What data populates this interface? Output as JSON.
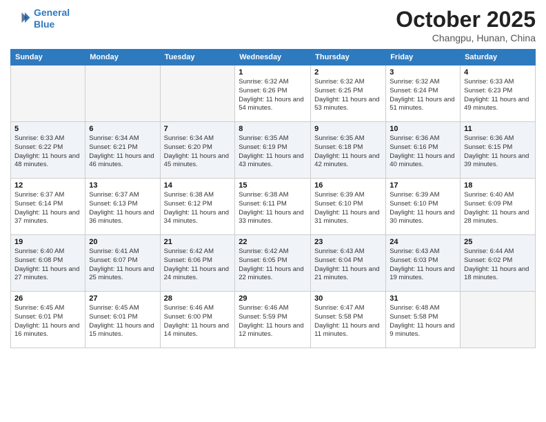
{
  "header": {
    "logo_line1": "General",
    "logo_line2": "Blue",
    "month": "October 2025",
    "location": "Changpu, Hunan, China"
  },
  "weekdays": [
    "Sunday",
    "Monday",
    "Tuesday",
    "Wednesday",
    "Thursday",
    "Friday",
    "Saturday"
  ],
  "weeks": [
    [
      {
        "day": "",
        "sunrise": "",
        "sunset": "",
        "daylight": ""
      },
      {
        "day": "",
        "sunrise": "",
        "sunset": "",
        "daylight": ""
      },
      {
        "day": "",
        "sunrise": "",
        "sunset": "",
        "daylight": ""
      },
      {
        "day": "1",
        "sunrise": "Sunrise: 6:32 AM",
        "sunset": "Sunset: 6:26 PM",
        "daylight": "Daylight: 11 hours and 54 minutes."
      },
      {
        "day": "2",
        "sunrise": "Sunrise: 6:32 AM",
        "sunset": "Sunset: 6:25 PM",
        "daylight": "Daylight: 11 hours and 53 minutes."
      },
      {
        "day": "3",
        "sunrise": "Sunrise: 6:32 AM",
        "sunset": "Sunset: 6:24 PM",
        "daylight": "Daylight: 11 hours and 51 minutes."
      },
      {
        "day": "4",
        "sunrise": "Sunrise: 6:33 AM",
        "sunset": "Sunset: 6:23 PM",
        "daylight": "Daylight: 11 hours and 49 minutes."
      }
    ],
    [
      {
        "day": "5",
        "sunrise": "Sunrise: 6:33 AM",
        "sunset": "Sunset: 6:22 PM",
        "daylight": "Daylight: 11 hours and 48 minutes."
      },
      {
        "day": "6",
        "sunrise": "Sunrise: 6:34 AM",
        "sunset": "Sunset: 6:21 PM",
        "daylight": "Daylight: 11 hours and 46 minutes."
      },
      {
        "day": "7",
        "sunrise": "Sunrise: 6:34 AM",
        "sunset": "Sunset: 6:20 PM",
        "daylight": "Daylight: 11 hours and 45 minutes."
      },
      {
        "day": "8",
        "sunrise": "Sunrise: 6:35 AM",
        "sunset": "Sunset: 6:19 PM",
        "daylight": "Daylight: 11 hours and 43 minutes."
      },
      {
        "day": "9",
        "sunrise": "Sunrise: 6:35 AM",
        "sunset": "Sunset: 6:18 PM",
        "daylight": "Daylight: 11 hours and 42 minutes."
      },
      {
        "day": "10",
        "sunrise": "Sunrise: 6:36 AM",
        "sunset": "Sunset: 6:16 PM",
        "daylight": "Daylight: 11 hours and 40 minutes."
      },
      {
        "day": "11",
        "sunrise": "Sunrise: 6:36 AM",
        "sunset": "Sunset: 6:15 PM",
        "daylight": "Daylight: 11 hours and 39 minutes."
      }
    ],
    [
      {
        "day": "12",
        "sunrise": "Sunrise: 6:37 AM",
        "sunset": "Sunset: 6:14 PM",
        "daylight": "Daylight: 11 hours and 37 minutes."
      },
      {
        "day": "13",
        "sunrise": "Sunrise: 6:37 AM",
        "sunset": "Sunset: 6:13 PM",
        "daylight": "Daylight: 11 hours and 36 minutes."
      },
      {
        "day": "14",
        "sunrise": "Sunrise: 6:38 AM",
        "sunset": "Sunset: 6:12 PM",
        "daylight": "Daylight: 11 hours and 34 minutes."
      },
      {
        "day": "15",
        "sunrise": "Sunrise: 6:38 AM",
        "sunset": "Sunset: 6:11 PM",
        "daylight": "Daylight: 11 hours and 33 minutes."
      },
      {
        "day": "16",
        "sunrise": "Sunrise: 6:39 AM",
        "sunset": "Sunset: 6:10 PM",
        "daylight": "Daylight: 11 hours and 31 minutes."
      },
      {
        "day": "17",
        "sunrise": "Sunrise: 6:39 AM",
        "sunset": "Sunset: 6:10 PM",
        "daylight": "Daylight: 11 hours and 30 minutes."
      },
      {
        "day": "18",
        "sunrise": "Sunrise: 6:40 AM",
        "sunset": "Sunset: 6:09 PM",
        "daylight": "Daylight: 11 hours and 28 minutes."
      }
    ],
    [
      {
        "day": "19",
        "sunrise": "Sunrise: 6:40 AM",
        "sunset": "Sunset: 6:08 PM",
        "daylight": "Daylight: 11 hours and 27 minutes."
      },
      {
        "day": "20",
        "sunrise": "Sunrise: 6:41 AM",
        "sunset": "Sunset: 6:07 PM",
        "daylight": "Daylight: 11 hours and 25 minutes."
      },
      {
        "day": "21",
        "sunrise": "Sunrise: 6:42 AM",
        "sunset": "Sunset: 6:06 PM",
        "daylight": "Daylight: 11 hours and 24 minutes."
      },
      {
        "day": "22",
        "sunrise": "Sunrise: 6:42 AM",
        "sunset": "Sunset: 6:05 PM",
        "daylight": "Daylight: 11 hours and 22 minutes."
      },
      {
        "day": "23",
        "sunrise": "Sunrise: 6:43 AM",
        "sunset": "Sunset: 6:04 PM",
        "daylight": "Daylight: 11 hours and 21 minutes."
      },
      {
        "day": "24",
        "sunrise": "Sunrise: 6:43 AM",
        "sunset": "Sunset: 6:03 PM",
        "daylight": "Daylight: 11 hours and 19 minutes."
      },
      {
        "day": "25",
        "sunrise": "Sunrise: 6:44 AM",
        "sunset": "Sunset: 6:02 PM",
        "daylight": "Daylight: 11 hours and 18 minutes."
      }
    ],
    [
      {
        "day": "26",
        "sunrise": "Sunrise: 6:45 AM",
        "sunset": "Sunset: 6:01 PM",
        "daylight": "Daylight: 11 hours and 16 minutes."
      },
      {
        "day": "27",
        "sunrise": "Sunrise: 6:45 AM",
        "sunset": "Sunset: 6:01 PM",
        "daylight": "Daylight: 11 hours and 15 minutes."
      },
      {
        "day": "28",
        "sunrise": "Sunrise: 6:46 AM",
        "sunset": "Sunset: 6:00 PM",
        "daylight": "Daylight: 11 hours and 14 minutes."
      },
      {
        "day": "29",
        "sunrise": "Sunrise: 6:46 AM",
        "sunset": "Sunset: 5:59 PM",
        "daylight": "Daylight: 11 hours and 12 minutes."
      },
      {
        "day": "30",
        "sunrise": "Sunrise: 6:47 AM",
        "sunset": "Sunset: 5:58 PM",
        "daylight": "Daylight: 11 hours and 11 minutes."
      },
      {
        "day": "31",
        "sunrise": "Sunrise: 6:48 AM",
        "sunset": "Sunset: 5:58 PM",
        "daylight": "Daylight: 11 hours and 9 minutes."
      },
      {
        "day": "",
        "sunrise": "",
        "sunset": "",
        "daylight": ""
      }
    ]
  ]
}
